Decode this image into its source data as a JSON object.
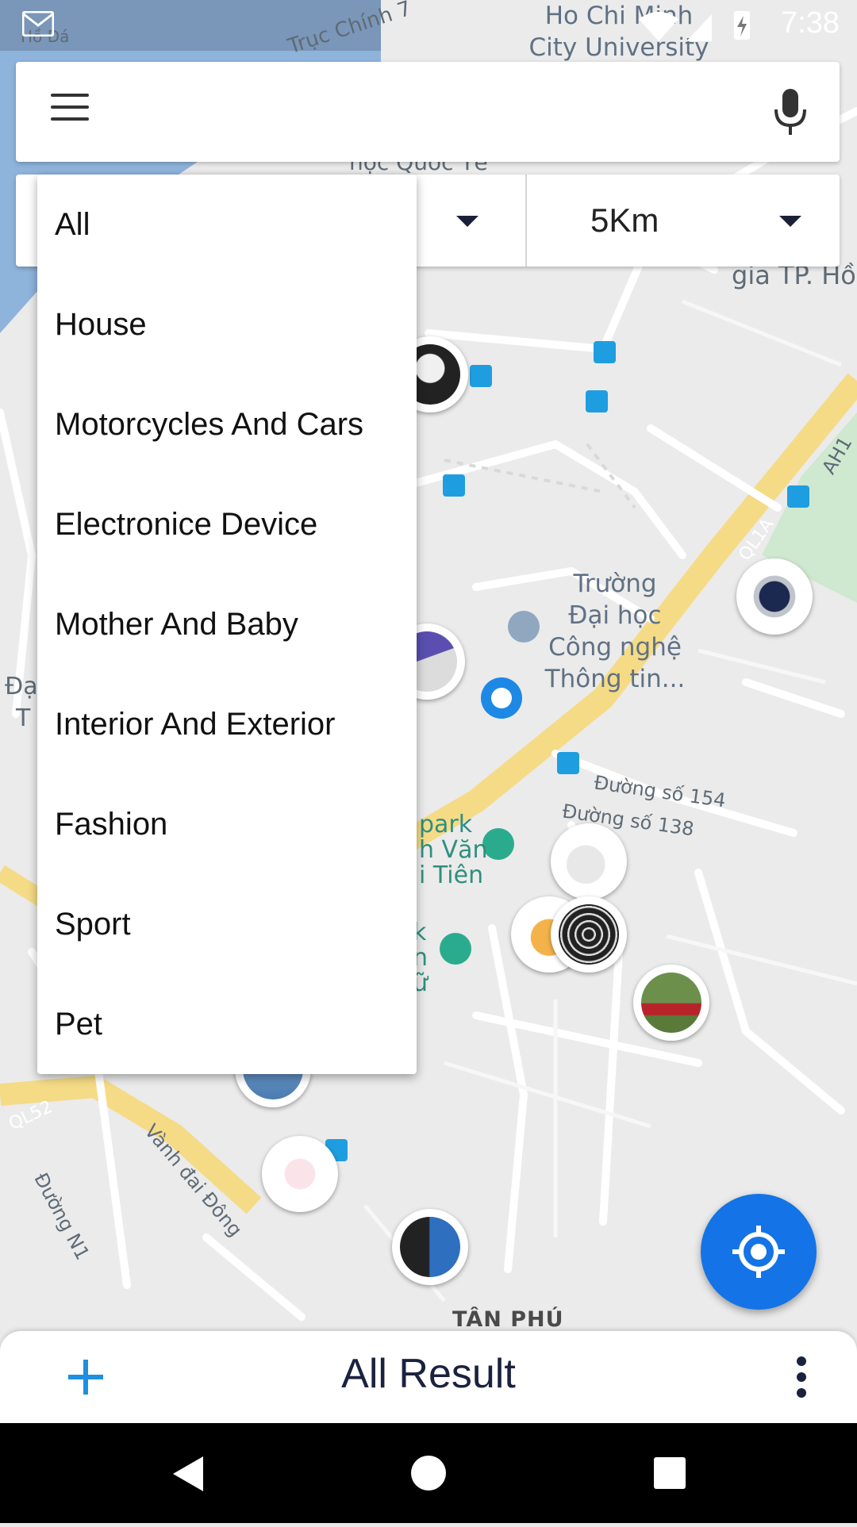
{
  "status_bar": {
    "time": "7:38",
    "gmail_icon": "gmail-icon",
    "wifi_icon": "wifi-icon",
    "signal_icon": "signal-icon",
    "battery_icon": "battery-charging-icon"
  },
  "map": {
    "labels": {
      "university": "Ho Chi Minh\nCity University",
      "truc_chinh": "Trục Chính 7",
      "ho_da": "Hồ Đá",
      "quoc_te": "học Quốc Tế",
      "gia_tp": "gia TP. Hồ",
      "truong": "Trường\nĐại học\nCông nghệ\nThông tin...",
      "dai": "Đạ",
      "tp": "T",
      "ah1": "AH1",
      "ql1a": "QL1A",
      "duong154": "Đường số 154",
      "duong138": "Đường số 138",
      "park": "park\nh Văn\ni Tiên",
      "k": "k\nn\nữ",
      "ql52": "QL52",
      "vanh_dai": "Vành đai Đông",
      "duong_n1": "Đường N1",
      "tan_phu": "TÂN PHÚ"
    }
  },
  "search": {
    "placeholder": "",
    "value": ""
  },
  "filter": {
    "category_selected": "All",
    "distance": "5Km"
  },
  "dropdown": {
    "items": [
      "All",
      "House",
      "Motorcycles And Cars",
      "Electronice Device",
      "Mother And Baby",
      "Interior And Exterior",
      "Fashion",
      "Sport",
      "Pet"
    ]
  },
  "bottom_bar": {
    "title": "All Result"
  },
  "colors": {
    "accent": "#1473e6",
    "title_text": "#1b2240"
  }
}
